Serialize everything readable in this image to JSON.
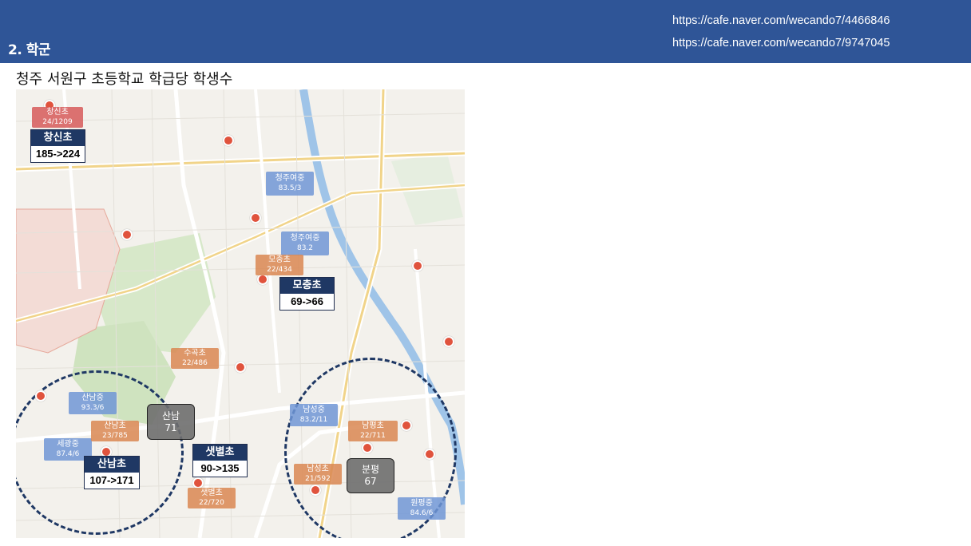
{
  "header": {
    "section_title": "2. 학군",
    "links": [
      "https://cafe.naver.com/wecando7/4466846",
      "https://cafe.naver.com/wecando7/9747045"
    ]
  },
  "page_title": "청주 서원구 초등학교 학급당 학생수",
  "colors": {
    "header_bg": "#2f5597",
    "middle_school": "#7096d6",
    "elementary_school": "#d98752",
    "label_red": "#d65a5a",
    "new_box": "#1f3864",
    "dashed_circle": "#1f3864"
  },
  "map": {
    "middle_school_labels": [
      {
        "name": "청주여중",
        "value": "83.5/3"
      },
      {
        "name": "청주여중",
        "value": "83.2"
      },
      {
        "name": "산남중",
        "value": "93.3/6"
      },
      {
        "name": "세광중",
        "value": "87.4/6"
      },
      {
        "name": "남성중",
        "value": "83.2/11"
      },
      {
        "name": "원평중",
        "value": "84.6/6"
      }
    ],
    "elementary_labels": [
      {
        "name": "모충초",
        "value": "22/434"
      },
      {
        "name": "수곡초",
        "value": "22/486"
      },
      {
        "name": "산남초",
        "value": "23/785"
      },
      {
        "name": "샛별초",
        "value": "22/720"
      },
      {
        "name": "남평초",
        "value": "22/711"
      },
      {
        "name": "남성초",
        "value": "21/592"
      }
    ],
    "red_labels": [
      {
        "name": "창신초",
        "value": "24/1209"
      }
    ],
    "gray_labels": [
      {
        "name": "산남",
        "value": "71"
      },
      {
        "name": "분평",
        "value": "67"
      }
    ],
    "change_boxes": [
      {
        "name": "창신초",
        "change": "185->224"
      },
      {
        "name": "모충초",
        "change": "69->66"
      },
      {
        "name": "샛별초",
        "change": "90->135"
      },
      {
        "name": "산남초",
        "change": "107->171"
      }
    ]
  }
}
